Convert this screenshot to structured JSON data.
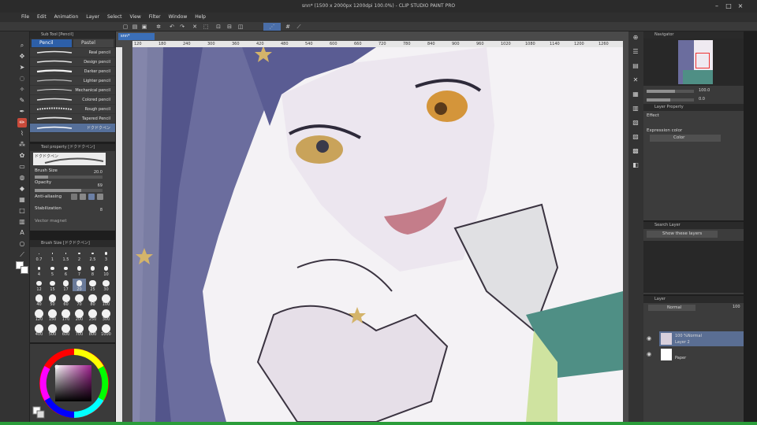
{
  "window": {
    "title": "snn* (1500 x 2000px 1200dpi 100.0%) - CLIP STUDIO PAINT PRO"
  },
  "menu": [
    "File",
    "Edit",
    "Animation",
    "Layer",
    "Select",
    "View",
    "Filter",
    "Window",
    "Help"
  ],
  "subtool": {
    "header": "Sub Tool [Pencil]",
    "tabs": [
      "Pencil",
      "Pastel"
    ],
    "brushes": [
      "Real pencil",
      "Design pencil",
      "Darker pencil",
      "Lighter pencil",
      "Mechanical pencil",
      "Colored pencil",
      "Rough pencil",
      "Tapered Pencil",
      "ドクドクペン"
    ]
  },
  "toolprop": {
    "header": "Tool property [ドクドクペン]",
    "preset_name": "ドクドクペン",
    "brush_size_label": "Brush Size",
    "brush_size_value": "20.0",
    "brush_size_fraction": 0.2,
    "opacity_label": "Opacity",
    "opacity_value": "69",
    "opacity_fraction": 0.69,
    "antialias_label": "Anti-aliasing",
    "stabilization_label": "Stabilization",
    "stabilization_value": "8",
    "vector_label": "Vector magnet"
  },
  "brushsize": {
    "header": "Brush Size [ドクドクペン]",
    "sizes": [
      "0.7",
      "1",
      "1.5",
      "2",
      "2.5",
      "3",
      "4",
      "5",
      "6",
      "7",
      "8",
      "10",
      "12",
      "15",
      "17",
      "20",
      "25",
      "30",
      "40",
      "50",
      "60",
      "70",
      "80",
      "100",
      "120",
      "150",
      "170",
      "200",
      "250",
      "300",
      "400",
      "500",
      "600",
      "700",
      "800",
      "1000"
    ],
    "selected": "20"
  },
  "canvas": {
    "tab_label": "snn*",
    "ruler_ticks": [
      "120",
      "180",
      "240",
      "300",
      "360",
      "420",
      "480",
      "540",
      "600",
      "660",
      "720",
      "780",
      "840",
      "900",
      "960",
      "1020",
      "1080",
      "1140",
      "1200",
      "1260"
    ]
  },
  "navigator": {
    "header": "Navigator",
    "zoom": "100.0",
    "angle": "0.0"
  },
  "layerprop": {
    "header": "Layer Property",
    "effect_label": "Effect",
    "expr_label": "Expression color",
    "expr_value": "Color"
  },
  "searchlayer": {
    "header": "Search Layer",
    "filter": "Show these layers"
  },
  "layers": {
    "header": "Layer",
    "blend": "Normal",
    "opacity": "100",
    "items": [
      {
        "meta": "100 %Normal",
        "name": "Layer 2"
      },
      {
        "meta": "",
        "name": "Paper"
      }
    ]
  },
  "colors": {
    "accent": "#2d5fa8",
    "active_tool": "#c94a3a",
    "status": "#2a9d3a"
  }
}
